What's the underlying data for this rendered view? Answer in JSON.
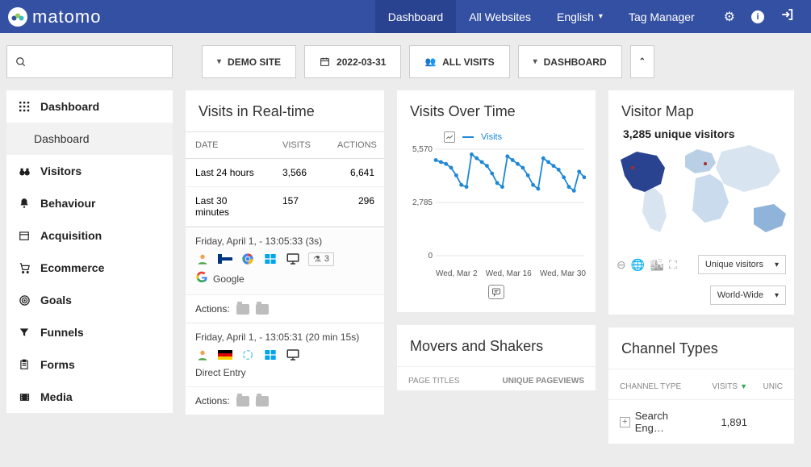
{
  "brand": {
    "name": "matomo"
  },
  "topnav": {
    "dashboard": "Dashboard",
    "allWebsites": "All Websites",
    "language": "English",
    "tagManager": "Tag Manager"
  },
  "controls": {
    "site": "DEMO SITE",
    "date": "2022-03-31",
    "segment": "ALL VISITS",
    "dashboard": "DASHBOARD"
  },
  "sidebar": {
    "items": [
      {
        "icon": "grid",
        "label": "Dashboard"
      },
      {
        "icon": "",
        "label": "Dashboard",
        "sub": true
      },
      {
        "icon": "binoculars",
        "label": "Visitors"
      },
      {
        "icon": "bell",
        "label": "Behaviour"
      },
      {
        "icon": "calendar",
        "label": "Acquisition"
      },
      {
        "icon": "cart",
        "label": "Ecommerce"
      },
      {
        "icon": "target",
        "label": "Goals"
      },
      {
        "icon": "funnel",
        "label": "Funnels"
      },
      {
        "icon": "clipboard",
        "label": "Forms"
      },
      {
        "icon": "film",
        "label": "Media"
      }
    ]
  },
  "realtime": {
    "title": "Visits in Real-time",
    "headers": {
      "date": "DATE",
      "visits": "VISITS",
      "actions": "ACTIONS"
    },
    "rows": [
      {
        "label": "Last 24 hours",
        "visits": "3,566",
        "actions": "6,641"
      },
      {
        "label": "Last 30 minutes",
        "visits": "157",
        "actions": "296"
      }
    ],
    "feed": [
      {
        "time": "Friday, April 1, - 13:05:33 (3s)",
        "source": "Google",
        "badge": "3",
        "flag": "fi"
      },
      {
        "time": "Friday, April 1, - 13:05:31 (20 min 15s)",
        "source": "Direct Entry",
        "flag": "de"
      }
    ],
    "actionsLabel": "Actions:"
  },
  "overtime": {
    "title": "Visits Over Time",
    "legend": "Visits",
    "xTicks": [
      "Wed, Mar 2",
      "Wed, Mar 16",
      "Wed, Mar 30"
    ]
  },
  "chart_data": {
    "type": "line",
    "title": "Visits Over Time",
    "xlabel": "",
    "ylabel": "",
    "ylim": [
      0,
      5570
    ],
    "yTicks": [
      0,
      2785,
      5570
    ],
    "series": [
      {
        "name": "Visits",
        "x": [
          "Mar 1",
          "Mar 2",
          "Mar 3",
          "Mar 4",
          "Mar 5",
          "Mar 6",
          "Mar 7",
          "Mar 8",
          "Mar 9",
          "Mar 10",
          "Mar 11",
          "Mar 12",
          "Mar 13",
          "Mar 14",
          "Mar 15",
          "Mar 16",
          "Mar 17",
          "Mar 18",
          "Mar 19",
          "Mar 20",
          "Mar 21",
          "Mar 22",
          "Mar 23",
          "Mar 24",
          "Mar 25",
          "Mar 26",
          "Mar 27",
          "Mar 28",
          "Mar 29",
          "Mar 30"
        ],
        "values": [
          5000,
          4900,
          4800,
          4600,
          4200,
          3700,
          3600,
          5300,
          5100,
          4900,
          4700,
          4300,
          3800,
          3600,
          5200,
          5000,
          4800,
          4600,
          4200,
          3700,
          3500,
          5100,
          4900,
          4700,
          4500,
          4100,
          3600,
          3400,
          4400,
          4100
        ]
      }
    ]
  },
  "movers": {
    "title": "Movers and Shakers",
    "colPageTitles": "PAGE TITLES",
    "colUnique": "UNIQUE PAGEVIEWS"
  },
  "map": {
    "title": "Visitor Map",
    "summary": "3,285 unique visitors",
    "metric": "Unique visitors",
    "region": "World-Wide"
  },
  "channels": {
    "title": "Channel Types",
    "head": {
      "c1": "CHANNEL TYPE",
      "c2": "VISITS",
      "c3": "UNIC"
    },
    "rows": [
      {
        "label": "Search Eng…",
        "visits": "1,891"
      }
    ]
  }
}
